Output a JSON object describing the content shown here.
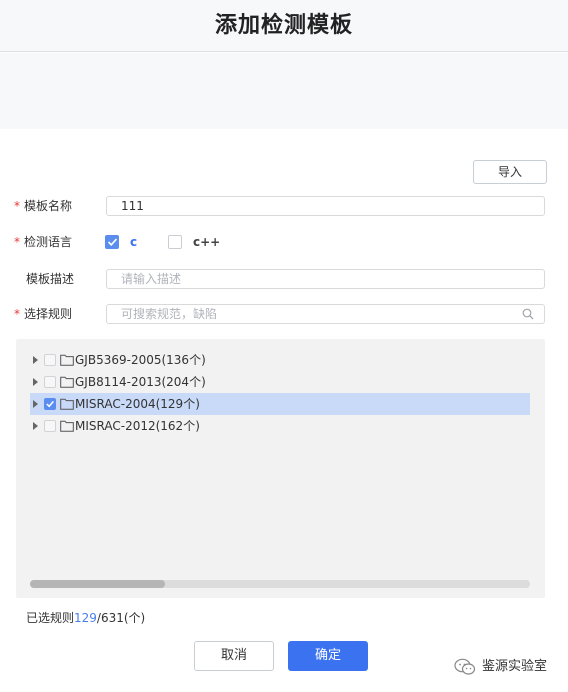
{
  "dialog": {
    "title": "添加检测模板",
    "import_label": "导入"
  },
  "form": {
    "name": {
      "label": "模板名称",
      "required": true,
      "value": "111"
    },
    "language": {
      "label": "检测语言",
      "required": true,
      "options": [
        {
          "label": "c",
          "checked": true
        },
        {
          "label": "c++",
          "checked": false
        }
      ]
    },
    "description": {
      "label": "模板描述",
      "required": false,
      "placeholder": "请输入描述"
    },
    "rules": {
      "label": "选择规则",
      "required": true,
      "placeholder": "可搜索规范，缺陷"
    }
  },
  "tree": {
    "items": [
      {
        "label": "GJB5369-2005(136个)",
        "checked": false,
        "selected": false
      },
      {
        "label": "GJB8114-2013(204个)",
        "checked": false,
        "selected": false
      },
      {
        "label": "MISRAC-2004(129个)",
        "checked": true,
        "selected": true
      },
      {
        "label": "MISRAC-2012(162个)",
        "checked": false,
        "selected": false
      }
    ],
    "horizontal_scroll_fraction": 0.27
  },
  "summary": {
    "prefix": "已选规则",
    "selected": "129",
    "total_text": "/631(个)"
  },
  "footer": {
    "cancel_label": "取消",
    "ok_label": "确定"
  },
  "watermark": {
    "text": "鉴源实验室",
    "icon": "wechat-icon"
  },
  "colors": {
    "accent": "#3b72f0",
    "required": "#e53935",
    "selected_row": "#c9d9f8"
  }
}
